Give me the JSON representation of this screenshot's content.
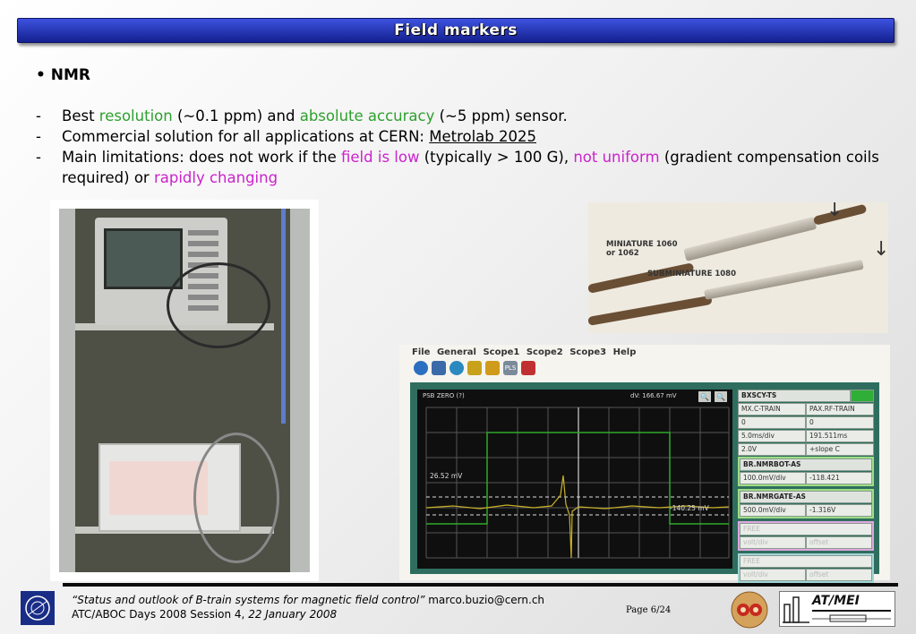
{
  "slide": {
    "title": "Field markers",
    "heading": "• NMR"
  },
  "bullets": {
    "b1": {
      "dash": "-",
      "p1": "Best ",
      "resolution": "resolution",
      "p2": " (~0.1 ppm) and ",
      "accuracy": "absolute accuracy",
      "p3": " (~5 ppm) sensor."
    },
    "b2": {
      "dash": "-",
      "p1": "Commercial solution for all applications at CERN: ",
      "link": "Metrolab 2025"
    },
    "b3": {
      "dash": "-",
      "p1": "Main limitations: does not work if the ",
      "field_low": "field is low",
      "p2": " (typically > 100 G), ",
      "not_uniform": "not uniform",
      "p3": " (gradient compensation coils required) or ",
      "rapid": "rapidly changing"
    }
  },
  "probe_photo": {
    "label_miniature": "MINIATURE 1060",
    "label_miniature_2": "or 1062",
    "label_subminiature": "SUBMINIATURE 1080"
  },
  "scope": {
    "menu": [
      "File",
      "General",
      "Scope1",
      "Scope2",
      "Scope3",
      "Help"
    ],
    "plot_left_label": "PSB ZERO (?)",
    "plot_dv_label": "dV: 166.67 mV",
    "marker_left": "26.52 mV",
    "marker_right": "-140.25 mV",
    "side_panel": {
      "title": "BXSCY-TS",
      "r1": [
        "MX.C-TRAIN",
        "PAX.RF-TRAIN"
      ],
      "r2": [
        "0",
        "0"
      ],
      "r3": [
        "5.0ms/div",
        "191.511ms"
      ],
      "r4": [
        "2.0V",
        "+slope  C"
      ],
      "ch1_name": "BR.NMRBOT-AS",
      "ch1_vals": [
        "100.0mV/div",
        "-118.421"
      ],
      "ch2_name": "BR.NMRGATE-AS",
      "ch2_vals": [
        "500.0mV/div",
        "-1.316V"
      ],
      "ch3_name": "FREE",
      "ch3_vals": [
        "volt/div",
        "offset"
      ],
      "ch4_name": "FREE",
      "ch4_vals": [
        "volt/div",
        "offset"
      ]
    }
  },
  "footer": {
    "quote": "“Status and outlook of B-train systems for magnetic field control”",
    "email": " marco.buzio@cern.ch",
    "line2_a": "ATC/ABOC Days 2008 Session 4, ",
    "line2_b": "22 January 2008",
    "page": "Page 6/24",
    "logo_text": "AT/MEI"
  },
  "colors": {
    "green": "#2ea02e",
    "magenta": "#cc22cc",
    "title_bar": "#1e2bb3"
  }
}
